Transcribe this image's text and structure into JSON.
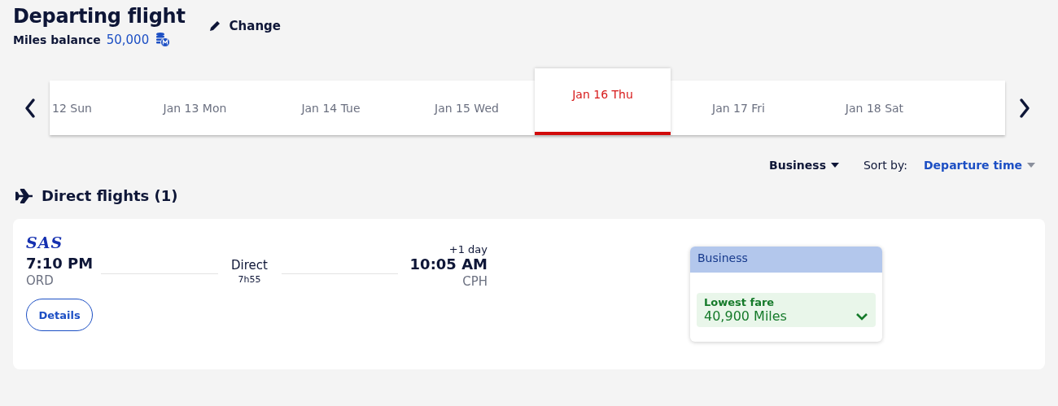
{
  "header": {
    "title": "Departing flight",
    "change_label": "Change",
    "miles_label": "Miles balance",
    "miles_value": "50,000"
  },
  "dates": [
    {
      "label": "12 Sun",
      "selected": false
    },
    {
      "label": "Jan 13 Mon",
      "selected": false
    },
    {
      "label": "Jan 14 Tue",
      "selected": false
    },
    {
      "label": "Jan 15 Wed",
      "selected": false
    },
    {
      "label": "Jan 16 Thu",
      "selected": true
    },
    {
      "label": "Jan 17 Fri",
      "selected": false
    },
    {
      "label": "Jan 18 Sat",
      "selected": false
    }
  ],
  "filters": {
    "cabin": "Business",
    "sort_label": "Sort by:",
    "sort_value": "Departure time"
  },
  "section_title": "Direct flights (1)",
  "flight": {
    "airline": "SAS",
    "depart_time": "7:10 PM",
    "depart_airport": "ORD",
    "stops": "Direct",
    "duration": "7h55",
    "day_offset": "+1 day",
    "arrive_time": "10:05 AM",
    "arrive_airport": "CPH",
    "details_label": "Details",
    "fare": {
      "cabin": "Business",
      "label": "Lowest fare",
      "price": "40,900 Miles",
      "expanded": false
    }
  }
}
